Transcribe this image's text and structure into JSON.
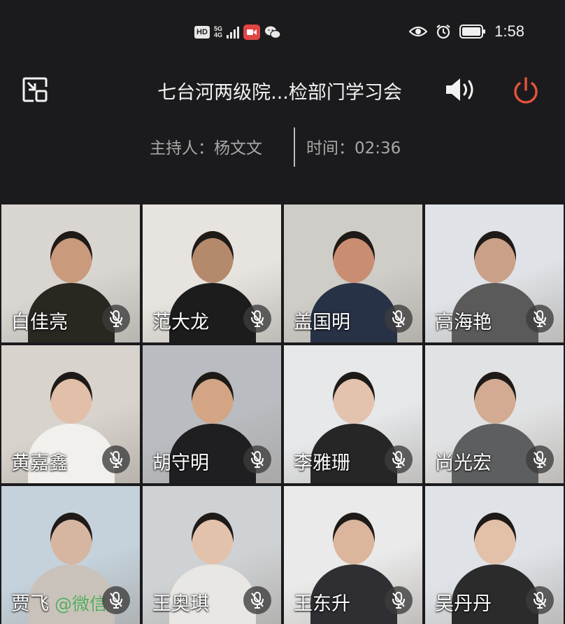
{
  "status_bar": {
    "hd_label": "HD",
    "network_top": "5G",
    "network_bottom": "4G",
    "time": "1:58",
    "icons": [
      "hd-icon",
      "signal-icon",
      "screen-record-icon",
      "wechat-icon",
      "eye-icon",
      "alarm-icon",
      "battery-icon"
    ]
  },
  "header": {
    "title": "七台河两级院...检部门学习会",
    "host": "主持人：杨文文",
    "time": "时间：02:36",
    "icons": [
      "minimize-icon",
      "speaker-icon",
      "power-icon"
    ],
    "colors": {
      "power": "#e5533d",
      "background": "#1b1b1d"
    }
  },
  "participants": [
    {
      "name": "白佳亮",
      "mic": "muted",
      "bg": "#d9d6d2",
      "skin": "#c99a7c",
      "shirt": "#2a2620"
    },
    {
      "name": "范大龙",
      "mic": "muted",
      "bg": "#e7e4df",
      "skin": "#b58a6c",
      "shirt": "#1c1c1c"
    },
    {
      "name": "盖国明",
      "mic": "muted",
      "bg": "#cfcdc8",
      "skin": "#c98e72",
      "shirt": "#273246"
    },
    {
      "name": "高海艳",
      "mic": "muted",
      "bg": "#dfe2e6",
      "skin": "#caa088",
      "shirt": "#5a5a5a"
    },
    {
      "name": "黄嘉鑫",
      "mic": "muted",
      "bg": "#d8d3cc",
      "skin": "#e1bfa8",
      "shirt": "#f2f0ec"
    },
    {
      "name": "胡守明",
      "mic": "muted",
      "bg": "#b9bcc0",
      "skin": "#d3a585",
      "shirt": "#1f1f22"
    },
    {
      "name": "李雅珊",
      "mic": "muted",
      "bg": "#e6e8ea",
      "skin": "#e4c3ae",
      "shirt": "#262626"
    },
    {
      "name": "尚光宏",
      "mic": "muted",
      "bg": "#e1e2e3",
      "skin": "#d2ab92",
      "shirt": "#5d5e60"
    },
    {
      "name": "贾飞",
      "watermark": "@微信",
      "mic": "muted",
      "bg": "#c5d2dc",
      "skin": "#d7b6a1",
      "shirt": "#c9c2ba"
    },
    {
      "name": "王奥琪",
      "mic": "muted",
      "bg": "#cfd2d4",
      "skin": "#e2c2ab",
      "shirt": "#e9e7e4"
    },
    {
      "name": "王东升",
      "mic": "muted",
      "bg": "#eaeaea",
      "skin": "#dbb59c",
      "shirt": "#2f2f33"
    },
    {
      "name": "吴丹丹",
      "mic": "muted",
      "bg": "#dfe3e8",
      "skin": "#e3c1a8",
      "shirt": "#2b2b2b"
    }
  ]
}
